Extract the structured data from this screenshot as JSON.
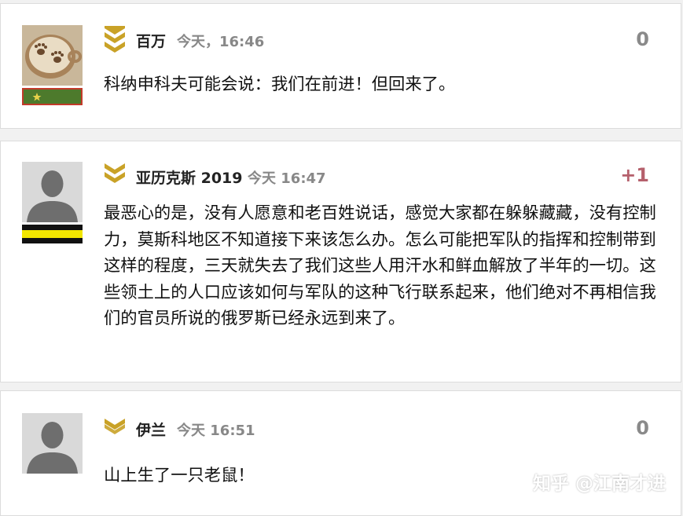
{
  "comments": [
    {
      "author": "百万",
      "time": "今天，16:46",
      "score": "0",
      "text": "科纳申科夫可能会说：我们在前进！但回来了。",
      "avatar_icon": "coffee-paw-icon",
      "rank_icon": "chevron-rank-icon"
    },
    {
      "author": "亚历克斯 2019",
      "time": "今天 16:47",
      "score": "+1",
      "text": "最恶心的是，没有人愿意和老百姓说话，感觉大家都在躲躲藏藏，没有控制力，莫斯科地区不知道接下来该怎么办。怎么可能把军队的指挥和控制带到这样的程度，三天就失去了我们这些人用汗水和鲜血解放了半年的一切。这些领土上的人口应该如何与军队的这种飞行联系起来，他们绝对不再相信我们的官员所说的俄罗斯已经永远到来了。",
      "avatar_icon": "default-user-icon",
      "rank_icon": "chevron-rank-icon"
    },
    {
      "author": "伊兰",
      "time": "今天 16:51",
      "score": "0",
      "text": "山上生了一只老鼠！",
      "avatar_icon": "default-user-icon",
      "rank_icon": "chevron-rank-icon"
    }
  ],
  "watermark": "知乎 @江南才进",
  "colors": {
    "rank_gold": "#c9a227",
    "score_positive": "#b5606c",
    "score_neutral": "#8a8a8a",
    "badge_yellow": "#f2e600"
  }
}
